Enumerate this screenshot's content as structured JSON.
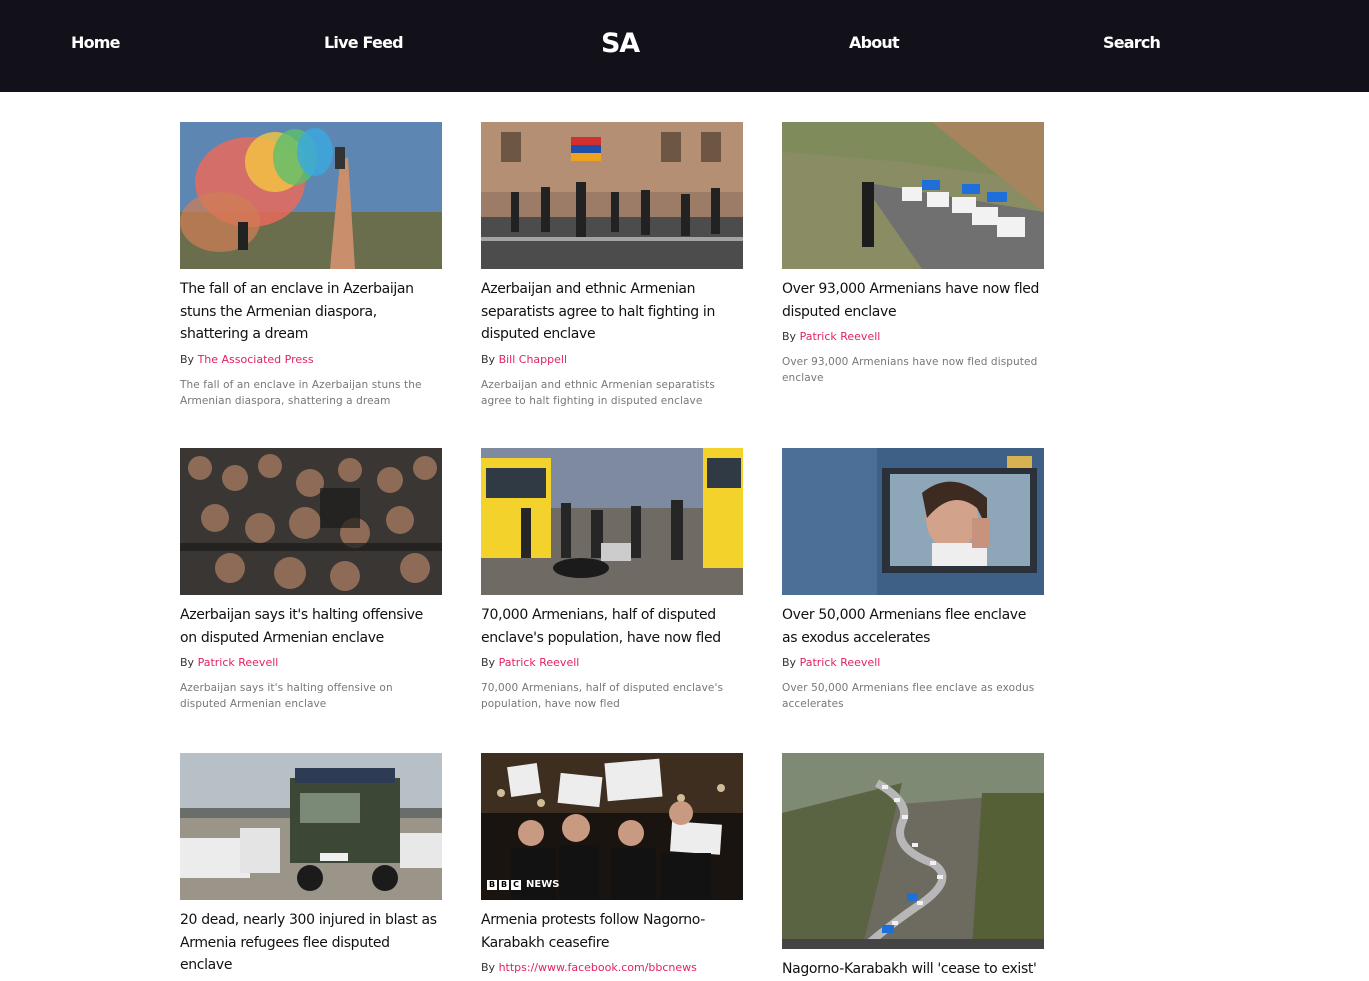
{
  "nav": {
    "home": "Home",
    "live_feed": "Live Feed",
    "logo": "SA",
    "about": "About",
    "search": "Search"
  },
  "byline_prefix": "By",
  "articles": [
    {
      "title": "The fall of an enclave in Azerbaijan stuns the Armenian diaspora, shattering a dream",
      "author": "The Associated Press",
      "summary": "The fall of an enclave in Azerbaijan stuns the Armenian diaspora, shattering a dream",
      "image": "colored-smoke-flare-photo"
    },
    {
      "title": "Azerbaijan and ethnic Armenian separatists agree to halt fighting in disputed enclave",
      "author": "Bill Chappell",
      "summary": "Azerbaijan and ethnic Armenian separatists agree to halt fighting in disputed enclave",
      "image": "street-protest-flag-photo"
    },
    {
      "title": "Over 93,000 Armenians have now fled disputed enclave",
      "author": "Patrick Reevell",
      "summary": "Over 93,000 Armenians have now fled disputed enclave",
      "image": "car-convoy-road-photo"
    },
    {
      "title": "Azerbaijan says it's halting offensive on disputed Armenian enclave",
      "author": "Patrick Reevell",
      "summary": "Azerbaijan says it's halting offensive on disputed Armenian enclave",
      "image": "crowd-clash-photo"
    },
    {
      "title": "70,000 Armenians, half of disputed enclave's population, have now fled",
      "author": "Patrick Reevell",
      "summary": "70,000 Armenians, half of disputed enclave's population, have now fled",
      "image": "refugees-buses-photo"
    },
    {
      "title": "Over 50,000 Armenians flee enclave as exodus accelerates",
      "author": "Patrick Reevell",
      "summary": "Over 50,000 Armenians flee enclave as exodus accelerates",
      "image": "woman-crying-window-photo"
    },
    {
      "title": "20 dead, nearly 300 injured in blast as Armenia refugees flee disputed enclave",
      "author": "",
      "summary": "",
      "image": "truck-refugees-photo"
    },
    {
      "title": "Armenia protests follow Nagorno-Karabakh ceasefire",
      "author": "https://www.facebook.com/bbcnews",
      "summary": "",
      "image": "night-protest-signs-photo",
      "badge": "NEWS"
    },
    {
      "title": "Nagorno-Karabakh will 'cease to exist'",
      "author": "",
      "summary": "",
      "image": "mountain-road-convoy-photo"
    }
  ]
}
